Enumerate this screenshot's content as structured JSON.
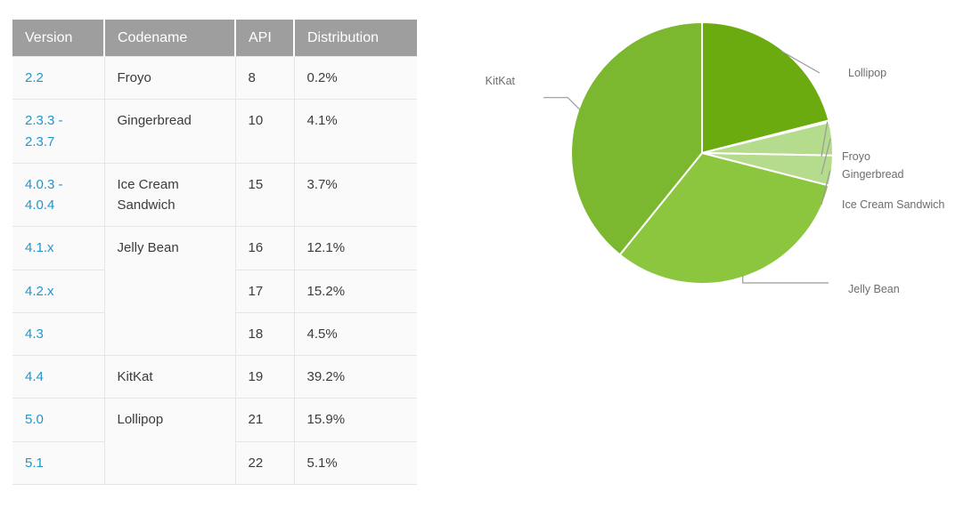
{
  "table": {
    "headers": [
      "Version",
      "Codename",
      "API",
      "Distribution"
    ],
    "rows": [
      {
        "version": [
          "2.2"
        ],
        "codename": "Froyo",
        "api": "8",
        "distribution": "0.2%"
      },
      {
        "version": [
          "2.3.3 -",
          "2.3.7"
        ],
        "codename": "Gingerbread",
        "api": "10",
        "distribution": "4.1%"
      },
      {
        "version": [
          "4.0.3 -",
          "4.0.4"
        ],
        "codename": "Ice Cream Sandwich",
        "api": "15",
        "distribution": "3.7%"
      },
      {
        "version": [
          "4.1.x"
        ],
        "codename": "Jelly Bean",
        "api": "16",
        "distribution": "12.1%"
      },
      {
        "version": [
          "4.2.x"
        ],
        "codename": "",
        "api": "17",
        "distribution": "15.2%"
      },
      {
        "version": [
          "4.3"
        ],
        "codename": "",
        "api": "18",
        "distribution": "4.5%"
      },
      {
        "version": [
          "4.4"
        ],
        "codename": "KitKat",
        "api": "19",
        "distribution": "39.2%"
      },
      {
        "version": [
          "5.0"
        ],
        "codename": "Lollipop",
        "api": "21",
        "distribution": "15.9%"
      },
      {
        "version": [
          "5.1"
        ],
        "codename": "",
        "api": "22",
        "distribution": "5.1%"
      }
    ]
  },
  "chart_data": {
    "type": "pie",
    "title": "",
    "legend_position": "callout-labels",
    "start_angle_deg": 0,
    "direction": "clockwise",
    "categories": [
      "Lollipop",
      "Froyo",
      "Gingerbread",
      "Ice Cream Sandwich",
      "Jelly Bean",
      "KitKat"
    ],
    "values": [
      21.0,
      0.2,
      4.1,
      3.7,
      31.8,
      39.2
    ],
    "labels": [
      "Lollipop",
      "Froyo",
      "Gingerbread",
      "Ice Cream Sandwich",
      "Jelly Bean",
      "KitKat"
    ],
    "colors": [
      "#6bab0f",
      "#d4ecb8",
      "#b5dc8c",
      "#b5dc8c",
      "#8cc63f",
      "#7cb82f"
    ],
    "units": "percent"
  },
  "colors": {
    "header_background": "#9e9e9e",
    "header_text": "#ffffff",
    "cell_background": "#fafafa",
    "cell_text": "#3b3b3b",
    "version_link": "#2196c9",
    "grid_border": "#e6e6e6",
    "label_text": "#6d6d6d",
    "leader_line": "#9a9a9a"
  }
}
